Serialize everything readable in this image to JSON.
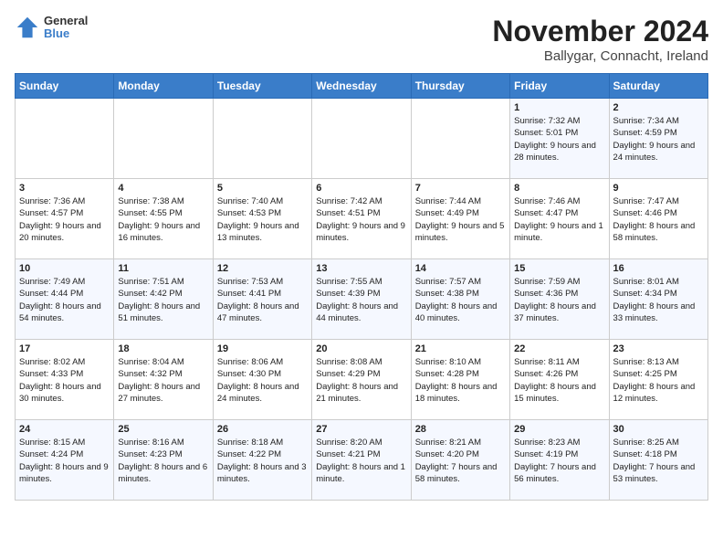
{
  "header": {
    "logo_general": "General",
    "logo_blue": "Blue",
    "title": "November 2024",
    "subtitle": "Ballygar, Connacht, Ireland"
  },
  "days_of_week": [
    "Sunday",
    "Monday",
    "Tuesday",
    "Wednesday",
    "Thursday",
    "Friday",
    "Saturday"
  ],
  "weeks": [
    [
      {
        "day": "",
        "info": ""
      },
      {
        "day": "",
        "info": ""
      },
      {
        "day": "",
        "info": ""
      },
      {
        "day": "",
        "info": ""
      },
      {
        "day": "",
        "info": ""
      },
      {
        "day": "1",
        "info": "Sunrise: 7:32 AM\nSunset: 5:01 PM\nDaylight: 9 hours and 28 minutes."
      },
      {
        "day": "2",
        "info": "Sunrise: 7:34 AM\nSunset: 4:59 PM\nDaylight: 9 hours and 24 minutes."
      }
    ],
    [
      {
        "day": "3",
        "info": "Sunrise: 7:36 AM\nSunset: 4:57 PM\nDaylight: 9 hours and 20 minutes."
      },
      {
        "day": "4",
        "info": "Sunrise: 7:38 AM\nSunset: 4:55 PM\nDaylight: 9 hours and 16 minutes."
      },
      {
        "day": "5",
        "info": "Sunrise: 7:40 AM\nSunset: 4:53 PM\nDaylight: 9 hours and 13 minutes."
      },
      {
        "day": "6",
        "info": "Sunrise: 7:42 AM\nSunset: 4:51 PM\nDaylight: 9 hours and 9 minutes."
      },
      {
        "day": "7",
        "info": "Sunrise: 7:44 AM\nSunset: 4:49 PM\nDaylight: 9 hours and 5 minutes."
      },
      {
        "day": "8",
        "info": "Sunrise: 7:46 AM\nSunset: 4:47 PM\nDaylight: 9 hours and 1 minute."
      },
      {
        "day": "9",
        "info": "Sunrise: 7:47 AM\nSunset: 4:46 PM\nDaylight: 8 hours and 58 minutes."
      }
    ],
    [
      {
        "day": "10",
        "info": "Sunrise: 7:49 AM\nSunset: 4:44 PM\nDaylight: 8 hours and 54 minutes."
      },
      {
        "day": "11",
        "info": "Sunrise: 7:51 AM\nSunset: 4:42 PM\nDaylight: 8 hours and 51 minutes."
      },
      {
        "day": "12",
        "info": "Sunrise: 7:53 AM\nSunset: 4:41 PM\nDaylight: 8 hours and 47 minutes."
      },
      {
        "day": "13",
        "info": "Sunrise: 7:55 AM\nSunset: 4:39 PM\nDaylight: 8 hours and 44 minutes."
      },
      {
        "day": "14",
        "info": "Sunrise: 7:57 AM\nSunset: 4:38 PM\nDaylight: 8 hours and 40 minutes."
      },
      {
        "day": "15",
        "info": "Sunrise: 7:59 AM\nSunset: 4:36 PM\nDaylight: 8 hours and 37 minutes."
      },
      {
        "day": "16",
        "info": "Sunrise: 8:01 AM\nSunset: 4:34 PM\nDaylight: 8 hours and 33 minutes."
      }
    ],
    [
      {
        "day": "17",
        "info": "Sunrise: 8:02 AM\nSunset: 4:33 PM\nDaylight: 8 hours and 30 minutes."
      },
      {
        "day": "18",
        "info": "Sunrise: 8:04 AM\nSunset: 4:32 PM\nDaylight: 8 hours and 27 minutes."
      },
      {
        "day": "19",
        "info": "Sunrise: 8:06 AM\nSunset: 4:30 PM\nDaylight: 8 hours and 24 minutes."
      },
      {
        "day": "20",
        "info": "Sunrise: 8:08 AM\nSunset: 4:29 PM\nDaylight: 8 hours and 21 minutes."
      },
      {
        "day": "21",
        "info": "Sunrise: 8:10 AM\nSunset: 4:28 PM\nDaylight: 8 hours and 18 minutes."
      },
      {
        "day": "22",
        "info": "Sunrise: 8:11 AM\nSunset: 4:26 PM\nDaylight: 8 hours and 15 minutes."
      },
      {
        "day": "23",
        "info": "Sunrise: 8:13 AM\nSunset: 4:25 PM\nDaylight: 8 hours and 12 minutes."
      }
    ],
    [
      {
        "day": "24",
        "info": "Sunrise: 8:15 AM\nSunset: 4:24 PM\nDaylight: 8 hours and 9 minutes."
      },
      {
        "day": "25",
        "info": "Sunrise: 8:16 AM\nSunset: 4:23 PM\nDaylight: 8 hours and 6 minutes."
      },
      {
        "day": "26",
        "info": "Sunrise: 8:18 AM\nSunset: 4:22 PM\nDaylight: 8 hours and 3 minutes."
      },
      {
        "day": "27",
        "info": "Sunrise: 8:20 AM\nSunset: 4:21 PM\nDaylight: 8 hours and 1 minute."
      },
      {
        "day": "28",
        "info": "Sunrise: 8:21 AM\nSunset: 4:20 PM\nDaylight: 7 hours and 58 minutes."
      },
      {
        "day": "29",
        "info": "Sunrise: 8:23 AM\nSunset: 4:19 PM\nDaylight: 7 hours and 56 minutes."
      },
      {
        "day": "30",
        "info": "Sunrise: 8:25 AM\nSunset: 4:18 PM\nDaylight: 7 hours and 53 minutes."
      }
    ]
  ]
}
